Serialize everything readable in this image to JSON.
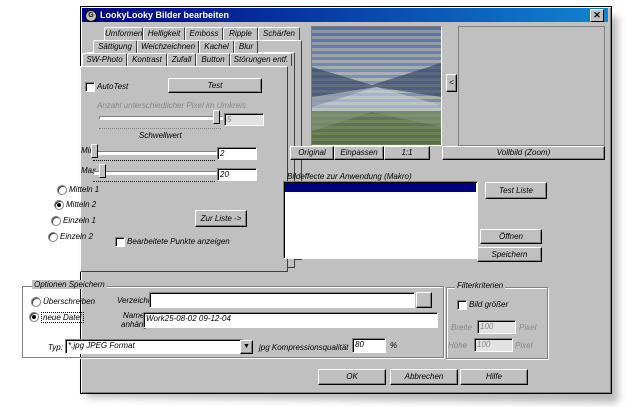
{
  "window": {
    "title": "LookyLooky Bilder bearbeiten",
    "close_glyph": "✕"
  },
  "tabs": {
    "row1": [
      "Umformen",
      "Helligkeit",
      "Emboss",
      "Ripple",
      "Schärfen"
    ],
    "row2": [
      "Sättigung",
      "Weichzeichnen",
      "Kachel",
      "Blur"
    ],
    "row3": [
      "SW-Photo",
      "Kontrast",
      "Zufall",
      "Button",
      "Störungen entf."
    ]
  },
  "filter_panel": {
    "autotest_label": "AutoTest",
    "test_button": "Test",
    "pixel_label": "Anzahl unterschiedlicher Pixel im Umkreis",
    "pixel_value": "5",
    "threshold_label": "Schwellwert",
    "min_label": "Min",
    "min_value": "2",
    "max_label": "Max",
    "max_value": "20",
    "radio_options": [
      "Mitteln 1",
      "Mitteln 2",
      "Einzeln 1",
      "Einzeln 2"
    ],
    "selected_option": "Mitteln 2",
    "add_to_list_button": "Zur Liste ->",
    "show_points_label": "Bearbeitete Punkte anzeigen"
  },
  "preview": {
    "original_button": "Original",
    "fit_button": "Einpassen",
    "ratio_button": "1:1",
    "fullscreen_button": "Vollbild (Zoom)",
    "arrow_glyph": "<"
  },
  "effects": {
    "list_label": "Bildeffecte zur Anwendung (Makro)",
    "test_list_button": "Test Liste",
    "open_button": "Öffnen",
    "save_button": "Speichern"
  },
  "save_options": {
    "group_title": "Optionen Speichern",
    "overwrite_label": "Überschreiben",
    "new_file_label": "neue Datei",
    "selected": "neue Datei",
    "directory_label": "Verzeichnis",
    "directory_value": "",
    "name_label_line1": "Name",
    "name_label_line2": "anhängen",
    "name_value": "Work25-08-02 09-12-04",
    "type_label": "Typ:",
    "type_value": "*.jpg JPEG Format",
    "quality_label": "jpg Kompressionsqualität",
    "quality_value": "80",
    "quality_unit": "%"
  },
  "filter_criteria": {
    "group_title": "Filterkriterien",
    "bigger_label": "Bild größer",
    "width_label": "Breite",
    "width_value": "100",
    "height_label": "Höhe",
    "height_value": "100",
    "pixel_unit": "Pixel"
  },
  "footer": {
    "ok": "OK",
    "cancel": "Abbrechen",
    "help": "Hilfe"
  },
  "colors": {
    "face": "#c0c0c0",
    "title_start": "#000080",
    "title_end": "#1084d0",
    "selection": "#000080"
  }
}
